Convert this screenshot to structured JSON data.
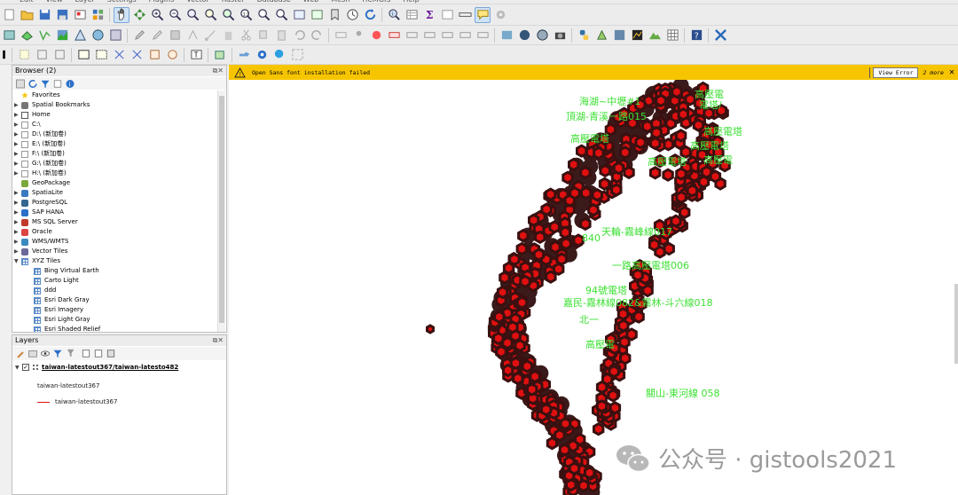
{
  "menu": {
    "items": [
      "Edit",
      "View",
      "Layer",
      "Settings",
      "Plugins",
      "Vector",
      "Raster",
      "Database",
      "Web",
      "Mesh",
      "HCMGIS",
      "Help"
    ]
  },
  "browser": {
    "title": "Browser (2)",
    "items": [
      {
        "label": "Favorites",
        "icon": "star-icon"
      },
      {
        "label": "Spatial Bookmarks",
        "icon": "bookmark-icon"
      },
      {
        "label": "Home",
        "icon": "home-icon"
      },
      {
        "label": "C:\\",
        "icon": "drive-icon"
      },
      {
        "label": "D:\\ (新加卷)",
        "icon": "drive-icon"
      },
      {
        "label": "E:\\ (新加卷)",
        "icon": "drive-icon"
      },
      {
        "label": "F:\\ (新加卷)",
        "icon": "drive-icon"
      },
      {
        "label": "G:\\ (新加卷)",
        "icon": "drive-icon"
      },
      {
        "label": "H:\\ (新加卷)",
        "icon": "drive-icon"
      },
      {
        "label": "GeoPackage",
        "icon": "geopackage-icon"
      },
      {
        "label": "SpatiaLite",
        "icon": "spatialite-icon"
      },
      {
        "label": "PostgreSQL",
        "icon": "postgresql-icon"
      },
      {
        "label": "SAP HANA",
        "icon": "saphana-icon"
      },
      {
        "label": "MS SQL Server",
        "icon": "mssql-icon"
      },
      {
        "label": "Oracle",
        "icon": "oracle-icon"
      },
      {
        "label": "WMS/WMTS",
        "icon": "wms-icon"
      },
      {
        "label": "Vector Tiles",
        "icon": "vector-tiles-icon"
      },
      {
        "label": "XYZ Tiles",
        "icon": "xyz-tiles-icon"
      },
      {
        "label": "Bing Virtual Earth",
        "icon": "tile-icon"
      },
      {
        "label": "Carto Light",
        "icon": "tile-icon"
      },
      {
        "label": "ddd",
        "icon": "tile-icon"
      },
      {
        "label": "Esri Dark Gray",
        "icon": "tile-icon"
      },
      {
        "label": "Esri Imagery",
        "icon": "tile-icon"
      },
      {
        "label": "Esri Light Gray",
        "icon": "tile-icon"
      },
      {
        "label": "Esri Shaded Relief",
        "icon": "tile-icon"
      }
    ]
  },
  "layers": {
    "title": "Layers",
    "layer_name": "taiwan-latestout367/taiwan-latesto482",
    "legend_group": "taiwan-latestout367",
    "legend_item": "taiwan-latestout367"
  },
  "message": {
    "text": "Open Sans font installation failed",
    "button": "View Error",
    "more": "2 more"
  },
  "map": {
    "labels": [
      "海湖~中壢#1",
      "頂湖-青溪一路015",
      "高壓電塔",
      "高壓電塔",
      "天輪-霧峰線017",
      "一路高壓電塔006",
      "94號電塔",
      "嘉民-霧林線082&霧林-斗六線018",
      "關山-東河線 058",
      "高壓電",
      "電塔/",
      "高壓電塔",
      "高壓電塔",
      "高壓電",
      "北一",
      "840",
      "高壓電"
    ],
    "point_color": "#e01010",
    "point_stroke": "#3a1010",
    "label_color": "#3de034"
  },
  "watermark": {
    "text": "公众号 · gistools2021"
  }
}
